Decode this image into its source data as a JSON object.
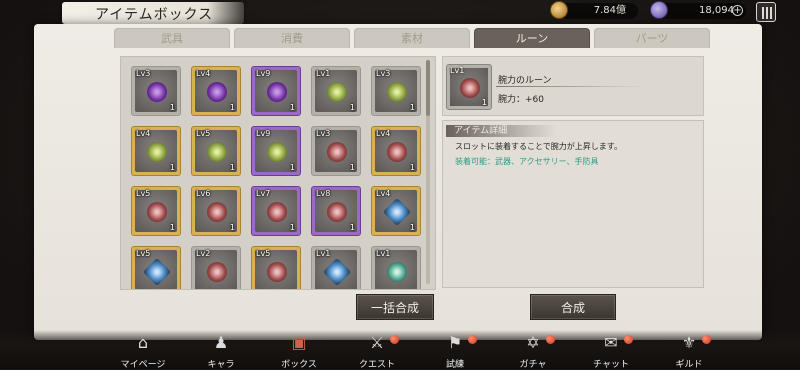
{
  "header": {
    "title": "アイテムボックス",
    "coins": "7.84億",
    "gems": "18,094",
    "plus_label": "+"
  },
  "tabs": [
    {
      "label": "武具",
      "active": false
    },
    {
      "label": "消費",
      "active": false
    },
    {
      "label": "素材",
      "active": false
    },
    {
      "label": "ルーン",
      "active": true
    },
    {
      "label": "パーツ",
      "active": false
    }
  ],
  "items": [
    {
      "lv": "Lv3",
      "qty": "1",
      "frame": "gray",
      "rune": "purple"
    },
    {
      "lv": "Lv4",
      "qty": "1",
      "frame": "gold",
      "rune": "purple"
    },
    {
      "lv": "Lv9",
      "qty": "1",
      "frame": "purple",
      "rune": "purple"
    },
    {
      "lv": "Lv1",
      "qty": "1",
      "frame": "gray",
      "rune": "green"
    },
    {
      "lv": "Lv3",
      "qty": "1",
      "frame": "gray",
      "rune": "green"
    },
    {
      "lv": "Lv4",
      "qty": "1",
      "frame": "gold",
      "rune": "green"
    },
    {
      "lv": "Lv5",
      "qty": "1",
      "frame": "gold",
      "rune": "green"
    },
    {
      "lv": "Lv9",
      "qty": "1",
      "frame": "purple",
      "rune": "green"
    },
    {
      "lv": "Lv3",
      "qty": "1",
      "frame": "gray",
      "rune": "red"
    },
    {
      "lv": "Lv4",
      "qty": "1",
      "frame": "gold",
      "rune": "red"
    },
    {
      "lv": "Lv5",
      "qty": "1",
      "frame": "gold",
      "rune": "red"
    },
    {
      "lv": "Lv6",
      "qty": "1",
      "frame": "gold",
      "rune": "red"
    },
    {
      "lv": "Lv7",
      "qty": "1",
      "frame": "purple",
      "rune": "red"
    },
    {
      "lv": "Lv8",
      "qty": "1",
      "frame": "purple",
      "rune": "red"
    },
    {
      "lv": "Lv4",
      "qty": "1",
      "frame": "gold",
      "rune": "blue"
    },
    {
      "lv": "Lv5",
      "qty": "",
      "frame": "gold",
      "rune": "blue"
    },
    {
      "lv": "Lv2",
      "qty": "",
      "frame": "gray",
      "rune": "red"
    },
    {
      "lv": "Lv5",
      "qty": "",
      "frame": "gold",
      "rune": "red"
    },
    {
      "lv": "Lv1",
      "qty": "",
      "frame": "gray",
      "rune": "blue"
    },
    {
      "lv": "Lv1",
      "qty": "",
      "frame": "gray",
      "rune": "teal"
    }
  ],
  "detail": {
    "lv": "Lv1",
    "qty": "1",
    "name": "腕力のルーン",
    "stat": "腕力：+60",
    "section_title": "アイテム詳細",
    "description": "スロットに装着することで腕力が上昇します。",
    "equippable": "装着可能：武器、アクセサリー、手防具"
  },
  "buttons": {
    "bulk_synth": "一括合成",
    "synth": "合成"
  },
  "nav": [
    {
      "label": "マイページ",
      "icon": "home-icon",
      "glyph": "⌂",
      "badge": false,
      "active": false
    },
    {
      "label": "キャラ",
      "icon": "characters-icon",
      "glyph": "♟",
      "badge": false,
      "active": false
    },
    {
      "label": "ボックス",
      "icon": "box-icon",
      "glyph": "▣",
      "badge": false,
      "active": true
    },
    {
      "label": "クエスト",
      "icon": "crossed-swords-icon",
      "glyph": "⚔",
      "badge": true,
      "active": false
    },
    {
      "label": "試練",
      "icon": "flag-icon",
      "glyph": "⚑",
      "badge": true,
      "active": false
    },
    {
      "label": "ガチャ",
      "icon": "gacha-icon",
      "glyph": "✡",
      "badge": true,
      "active": false
    },
    {
      "label": "チャット",
      "icon": "chat-icon",
      "glyph": "✉",
      "badge": true,
      "active": false
    },
    {
      "label": "ギルド",
      "icon": "guild-icon",
      "glyph": "⚜",
      "badge": true,
      "active": false
    }
  ]
}
